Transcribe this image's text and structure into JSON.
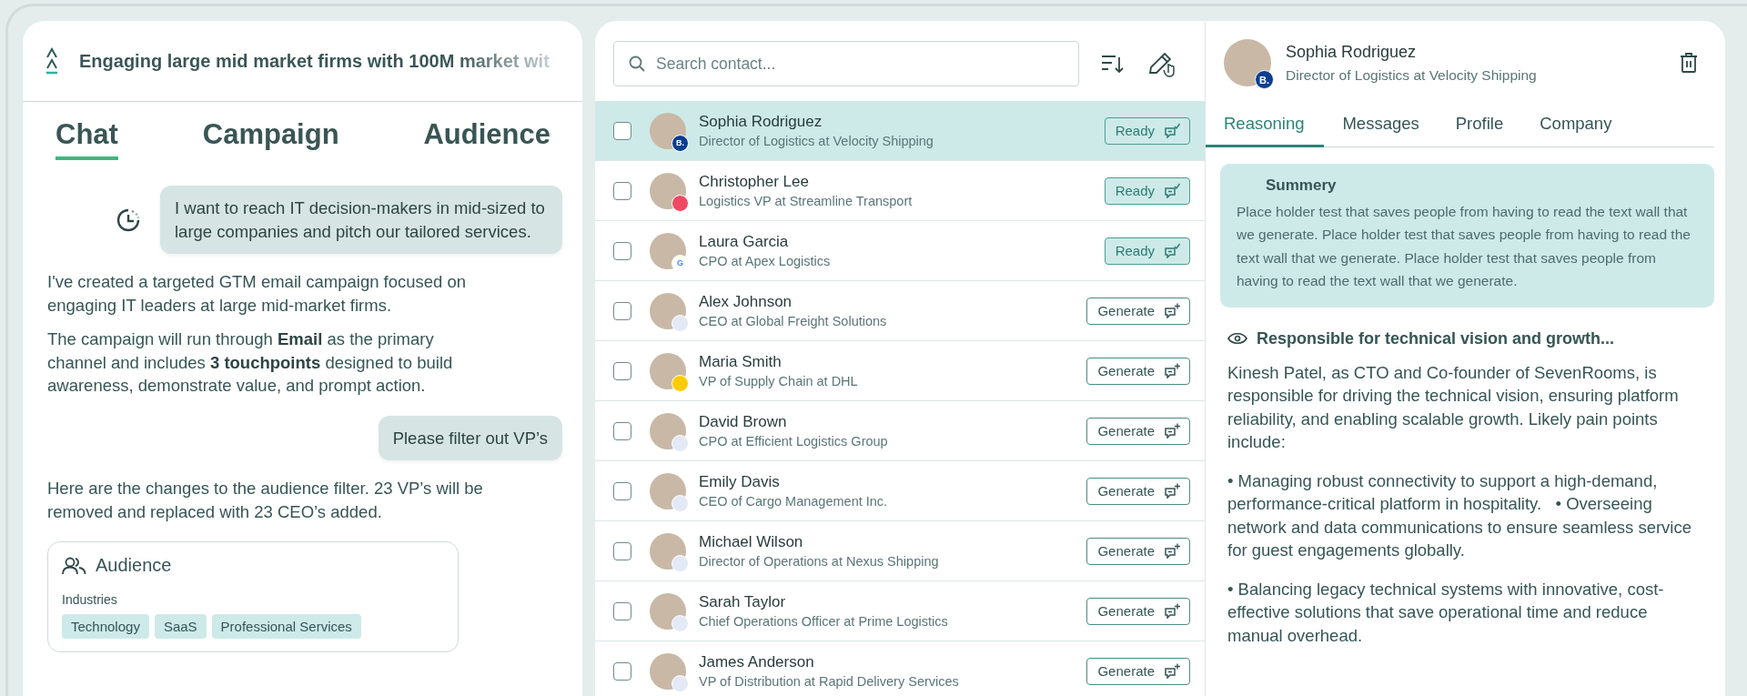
{
  "campaign": {
    "title": "Engaging large mid market firms with 100M market wit"
  },
  "left_tabs": [
    {
      "label": "Chat",
      "selected": true
    },
    {
      "label": "Campaign",
      "selected": false
    },
    {
      "label": "Audience",
      "selected": false
    }
  ],
  "messages": [
    {
      "kind": "user",
      "text": "I want to reach IT decision-makers in mid-sized to large companies and pitch our tailored services.",
      "pending": true
    },
    {
      "kind": "assistant",
      "text": "I've created a targeted GTM email campaign focused on engaging IT leaders at large mid-market firms."
    },
    {
      "kind": "assistant",
      "text": "The campaign will run through **Email** as the primary channel and includes **3 touchpoints** designed to build awareness, demonstrate value, and prompt action."
    },
    {
      "kind": "user",
      "text": "Please filter out VP’s",
      "pending": false
    },
    {
      "kind": "assistant",
      "text": "Here are the changes to the audience filter. 23 VP’s will be removed and replaced with 23 CEO’s added."
    }
  ],
  "audience_card": {
    "title": "Audience",
    "section": "Industries",
    "tags": [
      "Technology",
      "SaaS",
      "Professional Services"
    ]
  },
  "search": {
    "placeholder": "Search contact..."
  },
  "contacts": [
    {
      "name": "Sophia Rodriguez",
      "role": "Director of Logistics at Velocity Shipping",
      "selected": true,
      "checked": false,
      "color": "#0b3d91",
      "badge_label": "B.",
      "kind": "ready",
      "action": "Ready"
    },
    {
      "name": "Christopher Lee",
      "role": "Logistics VP at Streamline Transport",
      "selected": false,
      "checked": false,
      "color": "#ef4a63",
      "kind": "ready",
      "action": "Ready"
    },
    {
      "name": "Laura Garcia",
      "role": "CPO at Apex Logistics",
      "selected": false,
      "checked": false,
      "color": "#ffffff",
      "badge_label": "G",
      "kind": "ready",
      "action": "Ready"
    },
    {
      "name": "Alex Johnson",
      "role": "CEO at Global Freight Solutions",
      "selected": false,
      "checked": false,
      "color": "#e4e9f6",
      "kind": "generate",
      "action": "Generate"
    },
    {
      "name": "Maria Smith",
      "role": "VP of Supply Chain at DHL",
      "selected": false,
      "checked": false,
      "color": "#ffcc00",
      "kind": "generate",
      "action": "Generate"
    },
    {
      "name": "David Brown",
      "role": "CPO at Efficient Logistics Group",
      "selected": false,
      "checked": false,
      "color": "#e4e9f6",
      "kind": "generate",
      "action": "Generate"
    },
    {
      "name": "Emily Davis",
      "role": "CEO of Cargo Management Inc.",
      "selected": false,
      "checked": false,
      "color": "#e4e9f6",
      "kind": "generate",
      "action": "Generate"
    },
    {
      "name": "Michael Wilson",
      "role": "Director of Operations at Nexus Shipping",
      "selected": false,
      "checked": false,
      "color": "#e4e9f6",
      "kind": "generate",
      "action": "Generate"
    },
    {
      "name": "Sarah Taylor",
      "role": "Chief Operations Officer at Prime Logistics",
      "selected": false,
      "checked": false,
      "color": "#e4e9f6",
      "kind": "generate",
      "action": "Generate"
    },
    {
      "name": "James Anderson",
      "role": "VP of Distribution at Rapid Delivery Services",
      "selected": false,
      "checked": false,
      "color": "#e4e9f6",
      "kind": "generate",
      "action": "Generate"
    }
  ],
  "detail": {
    "name": "Sophia Rodriguez",
    "role": "Director of Logistics at Velocity Shipping",
    "color": "#0b3d91",
    "badge_label": "B.",
    "tabs": [
      {
        "label": "Reasoning",
        "selected": true
      },
      {
        "label": "Messages",
        "selected": false
      },
      {
        "label": "Profile",
        "selected": false
      },
      {
        "label": "Company",
        "selected": false
      }
    ],
    "summary": {
      "title": "Summery",
      "text": "Place holder test that saves people from having to read the text wall that we generate. Place holder test that saves people from having to read the text wall that we generate. Place holder test that saves people from having to read the text wall that we generate."
    },
    "insight_title": "Responsible for technical vision and growth...",
    "paragraphs": [
      "Kinesh Patel, as CTO and Co-founder of SevenRooms, is responsible for driving the technical vision, ensuring platform reliability, and enabling scalable growth. Likely pain points include:",
      "• Managing robust connectivity to support a high-demand, performance-critical platform in hospitality.   • Overseeing network and data communications to ensure seamless service for guest engagements globally.",
      "• Balancing legacy technical systems with innovative, cost-effective solutions that save operational time and reduce manual overhead."
    ]
  }
}
